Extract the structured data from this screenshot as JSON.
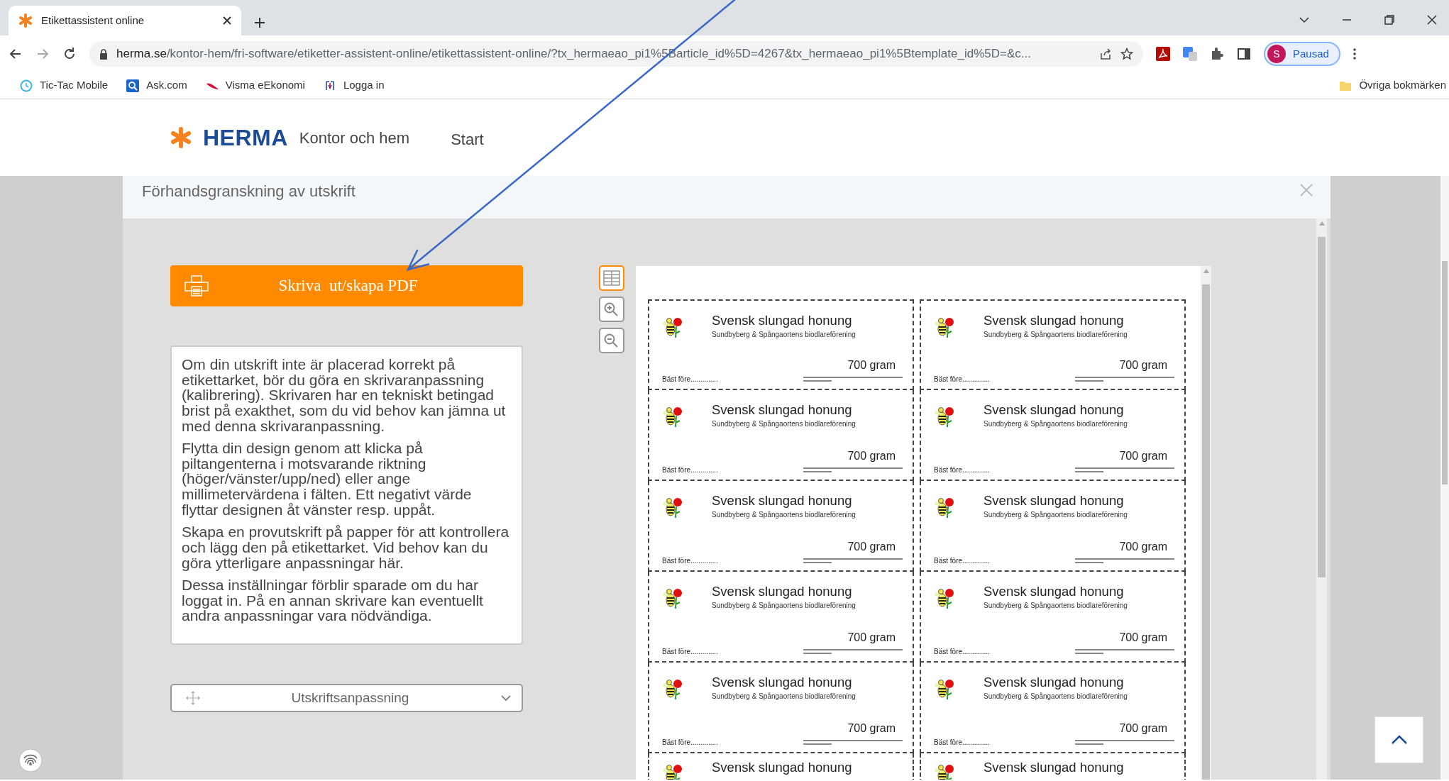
{
  "browser": {
    "tab": {
      "title": "Etikettassistent online"
    },
    "url": {
      "host": "herma.se",
      "path": "/kontor-hem/fri-software/etiketter-assistent-online/etikettassistent-online/?tx_hermaeao_pi1%5Barticle_id%5D=4267&tx_hermaeao_pi1%5Btemplate_id%5D=&c..."
    },
    "profile": {
      "initial": "S",
      "label": "Pausad"
    },
    "bookmarks": [
      {
        "label": "Tic-Tac Mobile",
        "kind": "clock"
      },
      {
        "label": "Ask.com",
        "kind": "search"
      },
      {
        "label": "Visma eEkonomi",
        "kind": "swoosh"
      },
      {
        "label": "Logga in",
        "kind": "login"
      }
    ],
    "other_bookmarks": "Övriga bokmärken"
  },
  "site": {
    "brand": "HERMA",
    "tagline": "Kontor och hem",
    "nav": [
      "Start"
    ]
  },
  "modal": {
    "title": "Förhandsgranskning av utskrift",
    "print_button": "Skriva  ut/skapa PDF",
    "paragraphs": [
      "Om din utskrift inte är placerad korrekt på etikettarket, bör du göra en skrivaranpassning (kalibrering). Skrivaren har en tekniskt betingad brist på exakthet, som du vid behov kan jämna ut med denna skrivaranpassning.",
      "Flytta din design genom att klicka på piltangenterna i motsvarande riktning (höger/vänster/upp/ned) eller ange millimetervärdena i fälten. Ett negativt värde flyttar designen åt vänster resp. uppåt.",
      "Skapa en provutskrift på papper för att kontrollera och lägg den på etikettarket. Vid behov kan du göra ytterligare anpassningar här.",
      "Dessa inställningar förblir sparade om du har loggat in. På en annan skrivare kan eventuellt andra anpassningar vara nödvändiga."
    ],
    "adjust_dropdown": {
      "label": "Utskriftsanpassning",
      "expanded": false
    },
    "view_tools": [
      {
        "kind": "grid",
        "selected": true
      },
      {
        "kind": "zoom-in",
        "selected": false
      },
      {
        "kind": "zoom-out",
        "selected": false
      }
    ],
    "labels": [
      {
        "title": "Svensk slungad honung",
        "subtitle": "Sundbyberg & Spångaortens biodlareförening",
        "weight": "700 gram",
        "best_before": "Bäst före.............."
      },
      {
        "title": "Svensk slungad honung",
        "subtitle": "Sundbyberg & Spångaortens biodlareförening",
        "weight": "700 gram",
        "best_before": "Bäst före.............."
      },
      {
        "title": "Svensk slungad honung",
        "subtitle": "Sundbyberg & Spångaortens biodlareförening",
        "weight": "700 gram",
        "best_before": "Bäst före.............."
      },
      {
        "title": "Svensk slungad honung",
        "subtitle": "Sundbyberg & Spångaortens biodlareförening",
        "weight": "700 gram",
        "best_before": "Bäst före.............."
      },
      {
        "title": "Svensk slungad honung",
        "subtitle": "Sundbyberg & Spångaortens biodlareförening",
        "weight": "700 gram",
        "best_before": "Bäst före.............."
      },
      {
        "title": "Svensk slungad honung",
        "subtitle": "Sundbyberg & Spångaortens biodlareförening",
        "weight": "700 gram",
        "best_before": "Bäst före.............."
      },
      {
        "title": "Svensk slungad honung",
        "subtitle": "Sundbyberg & Spångaortens biodlareförening",
        "weight": "700 gram",
        "best_before": "Bäst före.............."
      },
      {
        "title": "Svensk slungad honung",
        "subtitle": "Sundbyberg & Spångaortens biodlareförening",
        "weight": "700 gram",
        "best_before": "Bäst före.............."
      },
      {
        "title": "Svensk slungad honung",
        "subtitle": "Sundbyberg & Spångaortens biodlareförening",
        "weight": "700 gram",
        "best_before": "Bäst före.............."
      },
      {
        "title": "Svensk slungad honung",
        "subtitle": "Sundbyberg & Spångaortens biodlareförening",
        "weight": "700 gram",
        "best_before": "Bäst före.............."
      },
      {
        "title": "Svensk slungad honung"
      },
      {
        "title": "Svensk slungad honung"
      }
    ]
  }
}
